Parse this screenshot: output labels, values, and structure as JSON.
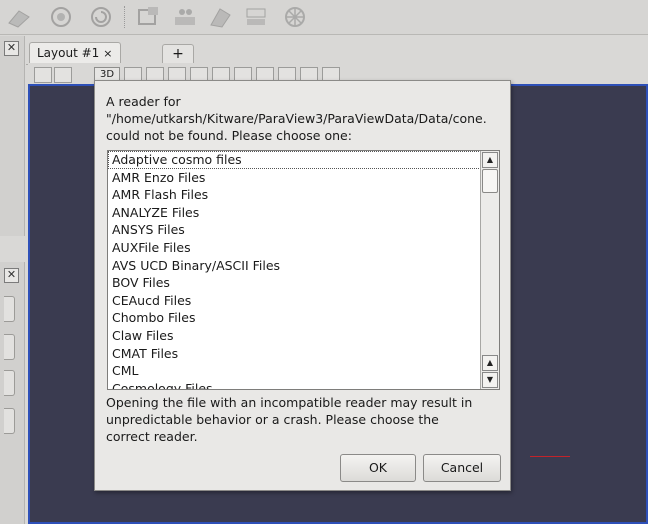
{
  "toolbar": {
    "icons": [
      "stretch-icon",
      "camera-link-icon",
      "camera-undo-icon",
      "box-select-icon",
      "surface-select-icon",
      "frustum-select-icon",
      "point-select-icon",
      "axes-grid-icon"
    ]
  },
  "tabs": {
    "layout_label": "Layout #1",
    "close_glyph": "×",
    "add_label": "+"
  },
  "view": {
    "mode_label": "3D",
    "border_color": "#2e50b8",
    "background_color": "#3a3b50"
  },
  "dialog": {
    "line1": "A reader for",
    "line2": "\"/home/utkarsh/Kitware/ParaView3/ParaViewData/Data/cone.",
    "line3": "could not be found.  Please choose one:",
    "readers": [
      "Adaptive cosmo files",
      "AMR Enzo Files",
      "AMR Flash Files",
      "ANALYZE Files",
      "ANSYS Files",
      "AUXFile Files",
      "AVS UCD Binary/ASCII Files",
      "BOV Files",
      "CEAucd Files",
      "Chombo Files",
      "Claw Files",
      "CMAT Files",
      "CML",
      "Cosmology Files"
    ],
    "warning_line1": "Opening the file with an incompatible reader may result in",
    "warning_line2": "unpredictable behavior or a crash.  Please choose the",
    "warning_line3": "correct reader.",
    "ok_label": "OK",
    "cancel_label": "Cancel"
  },
  "dock": {
    "close_glyph": "✕"
  }
}
